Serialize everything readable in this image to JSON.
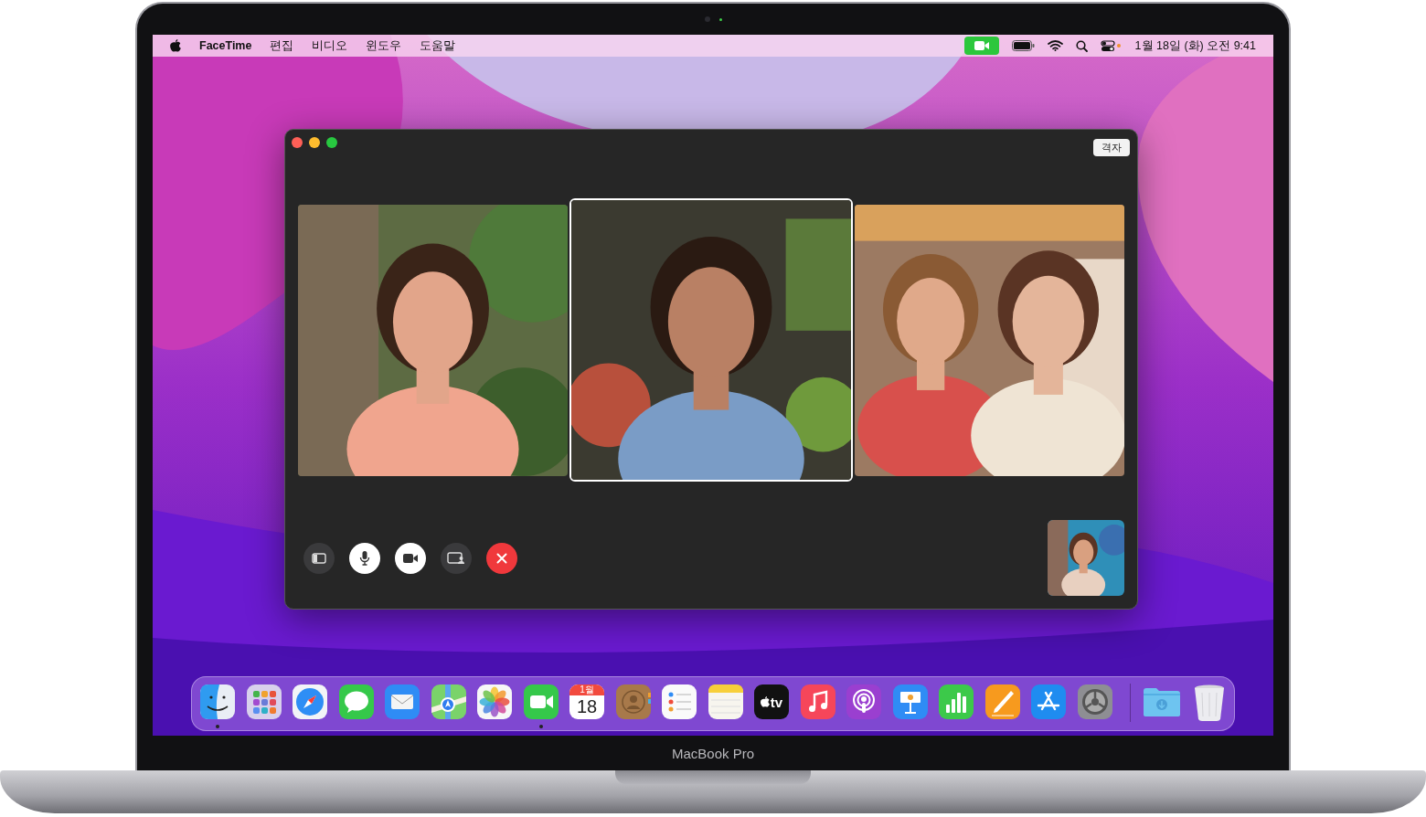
{
  "menu_bar": {
    "app_name": "FaceTime",
    "menus": [
      "편집",
      "비디오",
      "윈도우",
      "도움말"
    ],
    "camera_in_use": true,
    "clock": "1월 18일 (화) 오전 9:41"
  },
  "window": {
    "grid_button": "격자",
    "tiles": [
      {
        "kind": "garden",
        "selected": false
      },
      {
        "kind": "market",
        "selected": true
      },
      {
        "kind": "pair",
        "selected": false
      }
    ],
    "controls": [
      {
        "kind": "sidebar",
        "on": false
      },
      {
        "kind": "mic",
        "on": true
      },
      {
        "kind": "camera",
        "on": true
      },
      {
        "kind": "share",
        "on": false
      },
      {
        "kind": "end"
      }
    ],
    "self_view": {
      "kind": "selfie"
    }
  },
  "dock": {
    "apps": [
      {
        "kind": "finder",
        "running": true
      },
      {
        "kind": "launchpad",
        "running": false
      },
      {
        "kind": "safari",
        "running": false
      },
      {
        "kind": "messages",
        "running": false
      },
      {
        "kind": "mail",
        "running": false
      },
      {
        "kind": "maps",
        "running": false
      },
      {
        "kind": "photos",
        "running": false
      },
      {
        "kind": "facetime",
        "running": true
      },
      {
        "kind": "calendar",
        "running": false,
        "month": "1월",
        "day": "18"
      },
      {
        "kind": "contacts",
        "running": false
      },
      {
        "kind": "reminders",
        "running": false
      },
      {
        "kind": "notes",
        "running": false
      },
      {
        "kind": "tv",
        "running": false,
        "label": "tv"
      },
      {
        "kind": "music",
        "running": false
      },
      {
        "kind": "podcasts",
        "running": false
      },
      {
        "kind": "keynote",
        "running": false
      },
      {
        "kind": "numbers",
        "running": false
      },
      {
        "kind": "pages",
        "running": false
      },
      {
        "kind": "appstore",
        "running": false
      },
      {
        "kind": "settings",
        "running": false
      }
    ],
    "stacks": [
      {
        "kind": "downloads"
      },
      {
        "kind": "trash"
      }
    ]
  },
  "device_label": "MacBook Pro"
}
